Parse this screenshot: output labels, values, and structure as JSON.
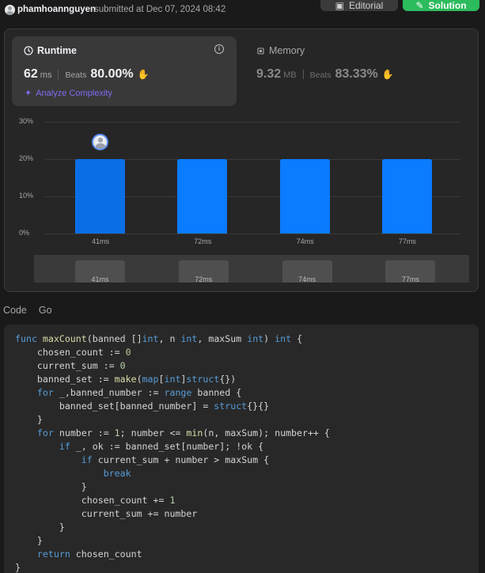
{
  "header": {
    "username": "phamhoannguyen",
    "submitted_text": "submitted at Dec 07, 2024 08:42",
    "editorial_label": "Editorial",
    "solution_label": "Solution"
  },
  "runtime": {
    "title": "Runtime",
    "value": "62",
    "unit": "ms",
    "beats_label": "Beats",
    "beats_pct": "80.00%",
    "analyze_label": "Analyze Complexity"
  },
  "memory": {
    "title": "Memory",
    "value": "9.32",
    "unit": "MB",
    "beats_label": "Beats",
    "beats_pct": "83.33%"
  },
  "chart_data": {
    "type": "bar",
    "categories": [
      "41ms",
      "72ms",
      "74ms",
      "77ms"
    ],
    "values": [
      20,
      20,
      20,
      20
    ],
    "ylim": [
      0,
      30
    ],
    "yticks": [
      "30%",
      "20%",
      "10%",
      "0%"
    ],
    "highlight_index": 0
  },
  "code": {
    "tab_code": "Code",
    "tab_lang": "Go"
  },
  "colors": {
    "accent_blue": "#0b7bff",
    "accent_green": "#2cbb5d",
    "accent_purple": "#7c6cf0"
  }
}
